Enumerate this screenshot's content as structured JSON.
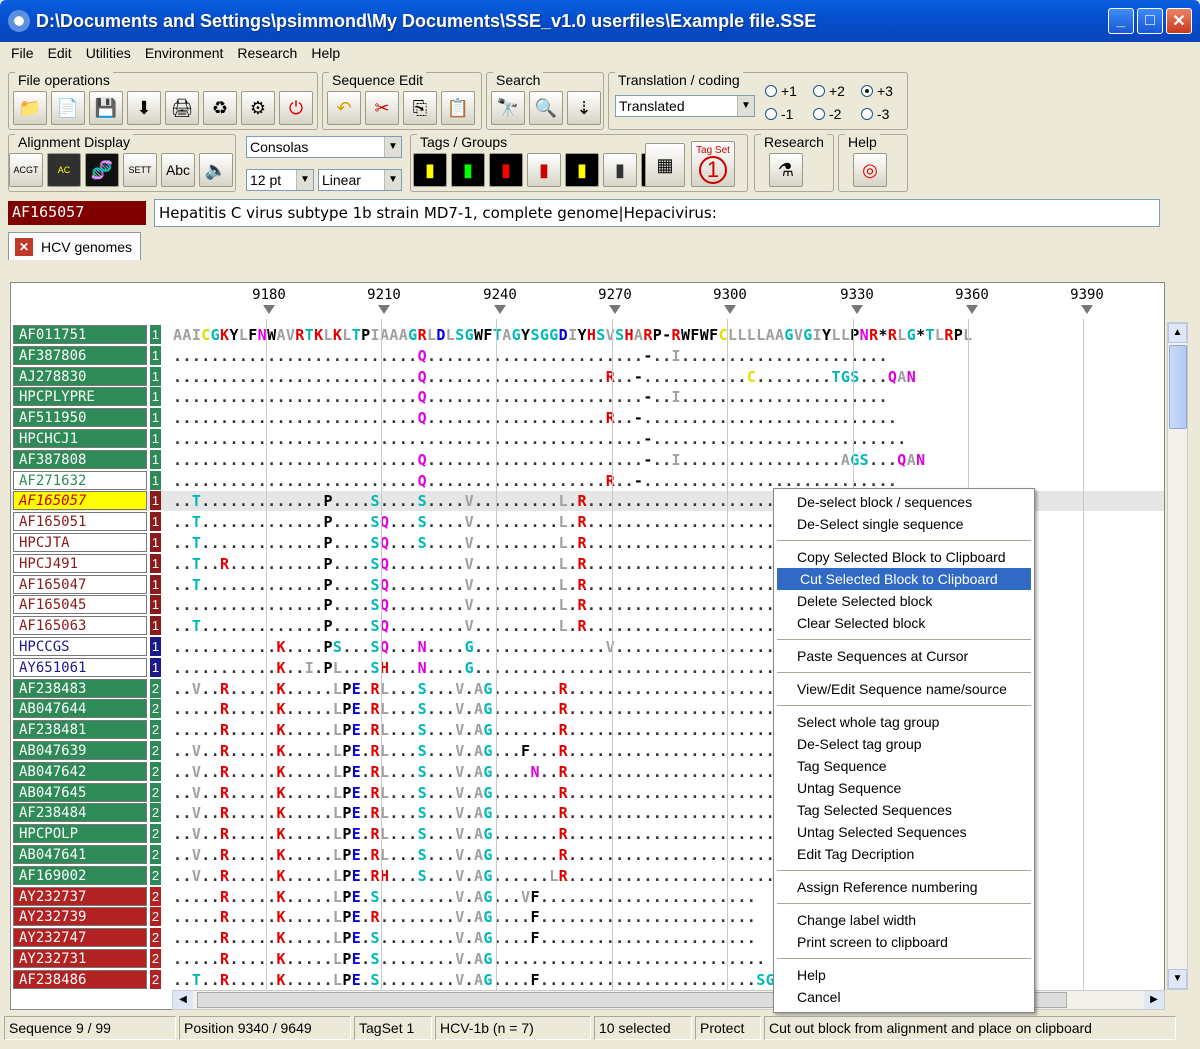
{
  "window": {
    "title": "D:\\Documents and Settings\\psimmond\\My Documents\\SSE_v1.0 userfiles\\Example file.SSE"
  },
  "menu": [
    "File",
    "Edit",
    "Utilities",
    "Environment",
    "Research",
    "Help"
  ],
  "toolbar": {
    "file_ops": "File operations",
    "seq_edit": "Sequence Edit",
    "search": "Search",
    "translation": "Translation / coding",
    "translation_mode": "Translated",
    "frames_pos": [
      "+1",
      "+2",
      "+3"
    ],
    "frames_neg": [
      "-1",
      "-2",
      "-3"
    ],
    "selected_frame": "+3",
    "align_display": "Alignment Display",
    "font_name": "Consolas",
    "font_size": "12 pt",
    "layout_mode": "Linear",
    "tags_groups": "Tags / Groups",
    "tag_set_label": "Tag Set",
    "tag_set_number": "1",
    "abc_label": "Abc",
    "research": "Research",
    "help": "Help"
  },
  "current_sequence": {
    "name": "AF165057",
    "description": "Hepatitis C virus subtype 1b strain MD7-1, complete genome|Hepacivirus:"
  },
  "tab": {
    "label": "HCV genomes"
  },
  "ruler": [
    "9180",
    "9210",
    "9240",
    "9270",
    "9300",
    "9330",
    "9360",
    "9390"
  ],
  "sequences": [
    {
      "name": "AF011751",
      "num": "1",
      "bg": "#2E8B57",
      "fg": "#FFFFFF",
      "nbg": "#2E8B57",
      "seq": "AAICGKYLFNWAVRTKLKLTPIAAAGRLDLSGWFTAGYSGGDIYHSVSHARP-RWFWFCLLLLAAGVGIYLLPNR*RLG*TLRPL"
    },
    {
      "name": "AF387806",
      "num": "1",
      "bg": "#2E8B57",
      "fg": "#FFFFFF",
      "nbg": "#2E8B57",
      "seq": "..........................Q.......................-..I......................"
    },
    {
      "name": "AJ278830",
      "num": "1",
      "bg": "#2E8B57",
      "fg": "#FFFFFF",
      "nbg": "#2E8B57",
      "seq": "..........................Q...................R..-...........C........TGS...QAN"
    },
    {
      "name": "HPCPLYPRE",
      "num": "1",
      "bg": "#2E8B57",
      "fg": "#FFFFFF",
      "nbg": "#2E8B57",
      "seq": "..........................Q.......................-..I......................"
    },
    {
      "name": "AF511950",
      "num": "1",
      "bg": "#2E8B57",
      "fg": "#FFFFFF",
      "nbg": "#2E8B57",
      "seq": "..........................Q...................R..-..........................."
    },
    {
      "name": "HPCHCJ1",
      "num": "1",
      "bg": "#2E8B57",
      "fg": "#FFFFFF",
      "nbg": "#2E8B57",
      "seq": "..................................................-..........................."
    },
    {
      "name": "AF387808",
      "num": "1",
      "bg": "#2E8B57",
      "fg": "#FFFFFF",
      "nbg": "#2E8B57",
      "seq": "..........................Q.......................-..I.................AGS...QAN"
    },
    {
      "name": "AF271632",
      "num": "1",
      "bg": "#FFFFFF",
      "fg": "#2E8B57",
      "nbg": "#2E8B57",
      "seq": "..........................Q...................R..-..........................."
    },
    {
      "name": "AF165057",
      "num": "1",
      "bg": "#FFFF00",
      "fg": "#CC0000",
      "nbg": "#8B1A1A",
      "seq": "..T.............P....S....S....V.........L.R.....................TGS.P."
    },
    {
      "name": "AF165051",
      "num": "1",
      "bg": "#FFFFFF",
      "fg": "#8B1A1A",
      "nbg": "#8B1A1A",
      "seq": "..T.............P....SQ...S....V.........L.R.....................TGS.P."
    },
    {
      "name": "HPCJTA",
      "num": "1",
      "bg": "#FFFFFF",
      "fg": "#8B1A1A",
      "nbg": "#8B1A1A",
      "seq": "..T.............P....SQ...S....V.........L.R.....................AGS.S.QAN"
    },
    {
      "name": "HPCJ491",
      "num": "1",
      "bg": "#FFFFFF",
      "fg": "#8B1A1A",
      "nbg": "#8B1A1A",
      "seq": "..T..R..........P....SQ........V.........L.R.....................TGS.P.QAN"
    },
    {
      "name": "AF165047",
      "num": "1",
      "bg": "#FFFFFF",
      "fg": "#8B1A1A",
      "nbg": "#8B1A1A",
      "seq": "..T.............P....SQ........V.........L.R.....................TGS.P."
    },
    {
      "name": "AF165045",
      "num": "1",
      "bg": "#FFFFFF",
      "fg": "#8B1A1A",
      "nbg": "#8B1A1A",
      "seq": "................P....SQ........V.........L.R.....................TGS.P.VYF"
    },
    {
      "name": "AF165063",
      "num": "1",
      "bg": "#FFFFFF",
      "fg": "#8B1A1A",
      "nbg": "#8B1A1A",
      "seq": "..T.............P....SQ........V.........L.R.....................TGS.P."
    },
    {
      "name": "HPCCGS",
      "num": "1",
      "bg": "#FFFFFF",
      "fg": "#1A1A8B",
      "nbg": "#1A1A8B",
      "seq": "...........K....PS...SQ...N....G..............V..................TV.QP.QAF"
    },
    {
      "name": "AY651061",
      "num": "1",
      "bg": "#FFFFFF",
      "fg": "#1A1A8B",
      "nbg": "#1A1A8B",
      "seq": "...........K..I.PL...SH...N....G.................................TV.QP.QAF"
    },
    {
      "name": "AF238483",
      "num": "2",
      "bg": "#2E8B57",
      "fg": "#FFFFFF",
      "nbg": "#2E8B57",
      "seq": "..V..R.....K.....LPE.RL...S...V.AG.......R.......................SGT"
    },
    {
      "name": "AB047644",
      "num": "2",
      "bg": "#2E8B57",
      "fg": "#FFFFFF",
      "nbg": "#2E8B57",
      "seq": ".....R.....K.....LPE.RL...S...V.AG.......R.......................SGTH*.HSI"
    },
    {
      "name": "AF238481",
      "num": "2",
      "bg": "#2E8B57",
      "fg": "#FFFFFF",
      "nbg": "#2E8B57",
      "seq": ".....R.....K.....LPE.RL...S...V.AG.......R.......................SGT"
    },
    {
      "name": "AB047639",
      "num": "2",
      "bg": "#2E8B57",
      "fg": "#FFFFFF",
      "nbg": "#2E8B57",
      "seq": "..V..R.....K.....LPE.RL...S...V.AG...F...R.......................SGTH*VHSI"
    },
    {
      "name": "AB047642",
      "num": "2",
      "bg": "#2E8B57",
      "fg": "#FFFFFF",
      "nbg": "#2E8B57",
      "seq": "..V..R.....K.....LPE.RL...S...V.AG....N..R.......................SGIH*.HSI"
    },
    {
      "name": "AB047645",
      "num": "2",
      "bg": "#2E8B57",
      "fg": "#FFFFFF",
      "nbg": "#2E8B57",
      "seq": "..V..R.....K.....LPE.RL...S...V.AG.......R.......................SGTH*.HSI"
    },
    {
      "name": "AF238484",
      "num": "2",
      "bg": "#2E8B57",
      "fg": "#FFFFFF",
      "nbg": "#2E8B57",
      "seq": "..V..R.....K.....LPE.RL...S...V.AG.......R.......................SGT"
    },
    {
      "name": "HPCPOLP",
      "num": "2",
      "bg": "#2E8B57",
      "fg": "#FFFFFF",
      "nbg": "#2E8B57",
      "seq": "..V..R.....K.....LPE.RL...S...V.AG.......R.......................SGTH*.HSI"
    },
    {
      "name": "AB047641",
      "num": "2",
      "bg": "#2E8B57",
      "fg": "#FFFFFF",
      "nbg": "#2E8B57",
      "seq": "..V..R.....K.....LPE.RL...S...V.AG.......R.......................SGTH*.HSI"
    },
    {
      "name": "AF169002",
      "num": "2",
      "bg": "#2E8B57",
      "fg": "#FFFFFF",
      "nbg": "#2E8B57",
      "seq": "..V..R.....K.....LPE.RH...S...V.AG......LR.......................SGTQ*.HSI"
    },
    {
      "name": "AY232737",
      "num": "2",
      "bg": "#B22222",
      "fg": "#FFFFFF",
      "nbg": "#B22222",
      "seq": ".....R.....K.....LPE.S........V.AG...VF......................."
    },
    {
      "name": "AY232739",
      "num": "2",
      "bg": "#B22222",
      "fg": "#FFFFFF",
      "nbg": "#B22222",
      "seq": ".....R.....K.....LPE.R........V.AG....F......................."
    },
    {
      "name": "AY232747",
      "num": "2",
      "bg": "#B22222",
      "fg": "#FFFFFF",
      "nbg": "#B22222",
      "seq": ".....R.....K.....LPE.S........V.AG....F......................."
    },
    {
      "name": "AY232731",
      "num": "2",
      "bg": "#B22222",
      "fg": "#FFFFFF",
      "nbg": "#B22222",
      "seq": ".....R.....K.....LPE.S........V.AG............................."
    },
    {
      "name": "AF238486",
      "num": "2",
      "bg": "#B22222",
      "fg": "#FFFFFF",
      "nbg": "#B22222",
      "seq": "..T..R.....K.....LPE.S........V.AG....F.......................SGKx"
    }
  ],
  "context_menu": [
    {
      "label": "De-select block / sequences"
    },
    {
      "label": "De-Select single sequence"
    },
    {
      "sep": true
    },
    {
      "label": "Copy Selected Block to Clipboard"
    },
    {
      "label": "Cut Selected Block to Clipboard",
      "selected": true
    },
    {
      "label": "Delete Selected block"
    },
    {
      "label": "Clear Selected block"
    },
    {
      "sep": true
    },
    {
      "label": "Paste Sequences at Cursor"
    },
    {
      "sep": true
    },
    {
      "label": "View/Edit Sequence name/source"
    },
    {
      "sep": true
    },
    {
      "label": "Select whole tag group"
    },
    {
      "label": "De-Select tag group"
    },
    {
      "label": "Tag Sequence"
    },
    {
      "label": "Untag Sequence"
    },
    {
      "label": "Tag Selected Sequences"
    },
    {
      "label": "Untag Selected Sequences"
    },
    {
      "label": "Edit Tag Decription"
    },
    {
      "sep": true
    },
    {
      "label": "Assign Reference numbering"
    },
    {
      "sep": true
    },
    {
      "label": "Change label width"
    },
    {
      "label": "Print screen to clipboard"
    },
    {
      "sep": true
    },
    {
      "label": "Help"
    },
    {
      "label": "Cancel"
    }
  ],
  "status": {
    "sequence": "Sequence 9 / 99",
    "position": "Position 9340 / 9649",
    "tagset": "TagSet 1",
    "group": "HCV-1b (n = 7)",
    "selected": "10 selected",
    "protect": "Protect",
    "hint": "Cut out block from alignment and place on clipboard"
  },
  "colors": {
    "R": "#E00000",
    "K": "#E00000",
    "H": "#E00000",
    "Q": "#E000E0",
    "N": "#E000E0",
    "S": "#00B8B8",
    "T": "#00B8B8",
    "G": "#00B8B8",
    "V": "#A0A0A0",
    "A": "#A0A0A0",
    "I": "#A0A0A0",
    "L": "#A0A0A0",
    "C": "#E0E000",
    "P": "#000000",
    "E": "#0000E0",
    "D": "#0000E0",
    "F": "#000000",
    "W": "#000000",
    "Y": "#000000",
    "M": "#000000",
    "*": "#000000"
  }
}
